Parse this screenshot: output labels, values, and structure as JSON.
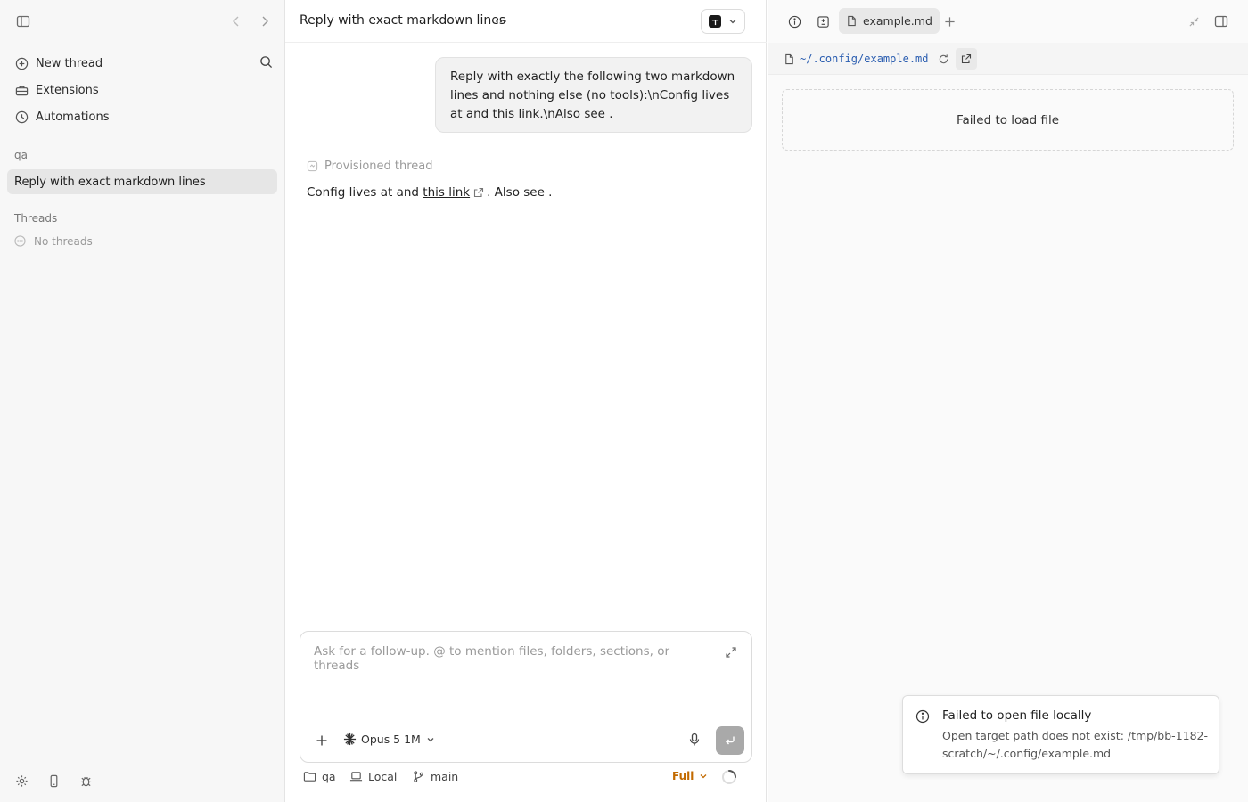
{
  "sidebar": {
    "nav": [
      {
        "label": "New thread",
        "icon": "plus-circle-icon"
      },
      {
        "label": "Extensions",
        "icon": "toolbox-icon"
      },
      {
        "label": "Automations",
        "icon": "clock-icon"
      }
    ],
    "project_label": "qa",
    "active_thread": "Reply with exact markdown lines",
    "threads_label": "Threads",
    "no_threads": "No threads"
  },
  "main": {
    "title": "Reply with exact markdown lines",
    "user_message": {
      "before_link": "Reply with exactly the following two markdown lines and nothing else (no tools):\\nConfig lives at and ",
      "link": "this link",
      "after_link": ".\\nAlso see ."
    },
    "provisioned_label": "Provisioned thread",
    "reply": {
      "before_link": "Config lives at and ",
      "link": "this link",
      "after_link": ". Also see ."
    },
    "composer": {
      "placeholder": "Ask for a follow-up. @ to mention files, folders, sections, or threads",
      "value": "",
      "model": "Opus 5 1M"
    },
    "footer": {
      "project": "qa",
      "environment": "Local",
      "branch": "main",
      "mode": "Full"
    }
  },
  "right_pane": {
    "tab_label": "example.md",
    "path": "~/.config/example.md",
    "load_error": "Failed to load file",
    "toast": {
      "title": "Failed to open file locally",
      "body": "Open target path does not exist: /tmp/bb-1182-scratch/~/.config/example.md"
    }
  },
  "colors": {
    "accent_mode": "#c26a00",
    "path_link": "#2a5db0",
    "send_button": "#a9a9a9"
  }
}
